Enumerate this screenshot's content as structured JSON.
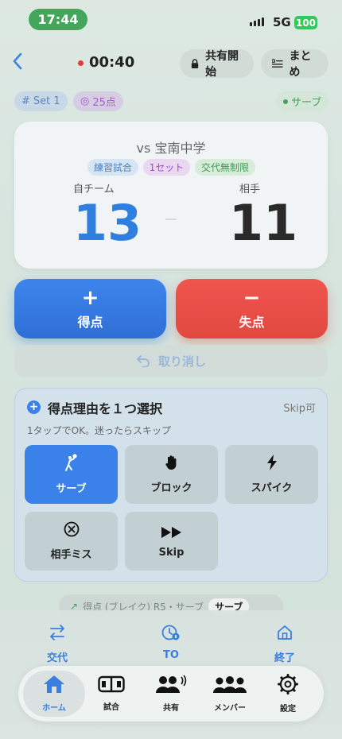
{
  "status": {
    "time": "17:44",
    "network": "5G",
    "battery": "100"
  },
  "header": {
    "timer": "00:40",
    "share_label": "共有開始",
    "summary_label": "まとめ"
  },
  "chips": {
    "set": "Set 1",
    "points": "25点",
    "serve": "サーブ"
  },
  "match": {
    "opponent": "vs 宝南中学",
    "tags": [
      "練習試合",
      "1セット",
      "交代無制限"
    ],
    "home_label": "自チーム",
    "opp_label": "相手",
    "home_score": "13",
    "opp_score": "11"
  },
  "actions_main": {
    "score_label": "得点",
    "loss_label": "失点",
    "undo_label": "取り消し"
  },
  "reason_panel": {
    "title": "得点理由を１つ選択",
    "skip_note": "Skip可",
    "subtitle": "1タップでOK。迷ったらスキップ",
    "buttons": [
      {
        "label": "サーブ",
        "icon": "serve-icon",
        "selected": true
      },
      {
        "label": "ブロック",
        "icon": "hand-icon",
        "selected": false
      },
      {
        "label": "スパイク",
        "icon": "bolt-icon",
        "selected": false
      },
      {
        "label": "相手ミス",
        "icon": "x-circle-icon",
        "selected": false
      },
      {
        "label": "Skip",
        "icon": "fast-forward-icon",
        "selected": false
      }
    ]
  },
  "toast": {
    "text": "得点 (ブレイク) R5・サーブ",
    "chip": "サーブ"
  },
  "bottom_actions": [
    {
      "label": "交代",
      "icon": "swap-icon"
    },
    {
      "label": "TO",
      "icon": "timeout-icon"
    },
    {
      "label": "終了",
      "icon": "home-end-icon"
    }
  ],
  "tabs": [
    {
      "label": "ホーム",
      "icon": "home-icon",
      "active": true
    },
    {
      "label": "試合",
      "icon": "court-icon",
      "active": false
    },
    {
      "label": "共有",
      "icon": "share-people-icon",
      "active": false
    },
    {
      "label": "メンバー",
      "icon": "members-icon",
      "active": false
    },
    {
      "label": "設定",
      "icon": "gear-icon",
      "active": false
    }
  ],
  "colors": {
    "accent": "#3a82ea",
    "danger": "#e04840",
    "success": "#43a65a"
  }
}
